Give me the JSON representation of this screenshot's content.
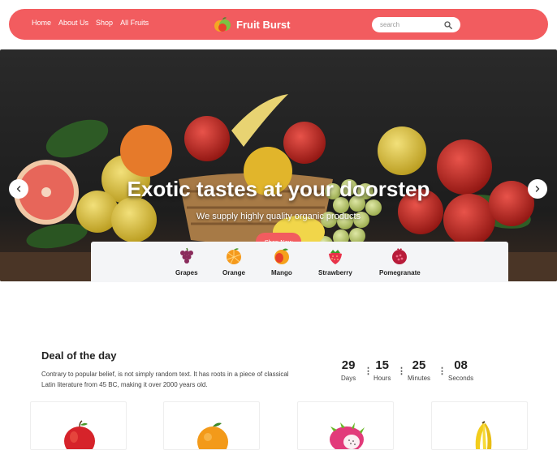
{
  "navbar": {
    "links": [
      "Home",
      "About Us",
      "Shop",
      "All Fruits"
    ],
    "brand": "Fruit Burst",
    "search_placeholder": "search",
    "bg_color": "#f25c5f"
  },
  "hero": {
    "title": "Exotic tastes at your doorstep",
    "subtitle": "We supply highly quality organic products",
    "cta_label": "Shop Now",
    "prev_icon": "chevron-left-icon",
    "next_icon": "chevron-right-icon"
  },
  "categories": [
    {
      "label": "Grapes",
      "icon": "grapes-icon"
    },
    {
      "label": "Orange",
      "icon": "orange-icon"
    },
    {
      "label": "Mango",
      "icon": "mango-icon"
    },
    {
      "label": "Strawberry",
      "icon": "strawberry-icon"
    },
    {
      "label": "Pomegranate",
      "icon": "pomegranate-icon"
    }
  ],
  "deal": {
    "title": "Deal of the day",
    "text": "Contrary to popular belief, is not simply random text. It has roots in a piece of classical Latin literature from 45 BC, making it over 2000 years old.",
    "countdown": [
      {
        "value": "29",
        "label": "Days"
      },
      {
        "value": "15",
        "label": "Hours"
      },
      {
        "value": "25",
        "label": "Minutes"
      },
      {
        "value": "08",
        "label": "Seconds"
      }
    ]
  },
  "products": [
    {
      "icon": "apple-icon"
    },
    {
      "icon": "orange-icon"
    },
    {
      "icon": "dragon-fruit-icon"
    },
    {
      "icon": "banana-icon"
    }
  ]
}
